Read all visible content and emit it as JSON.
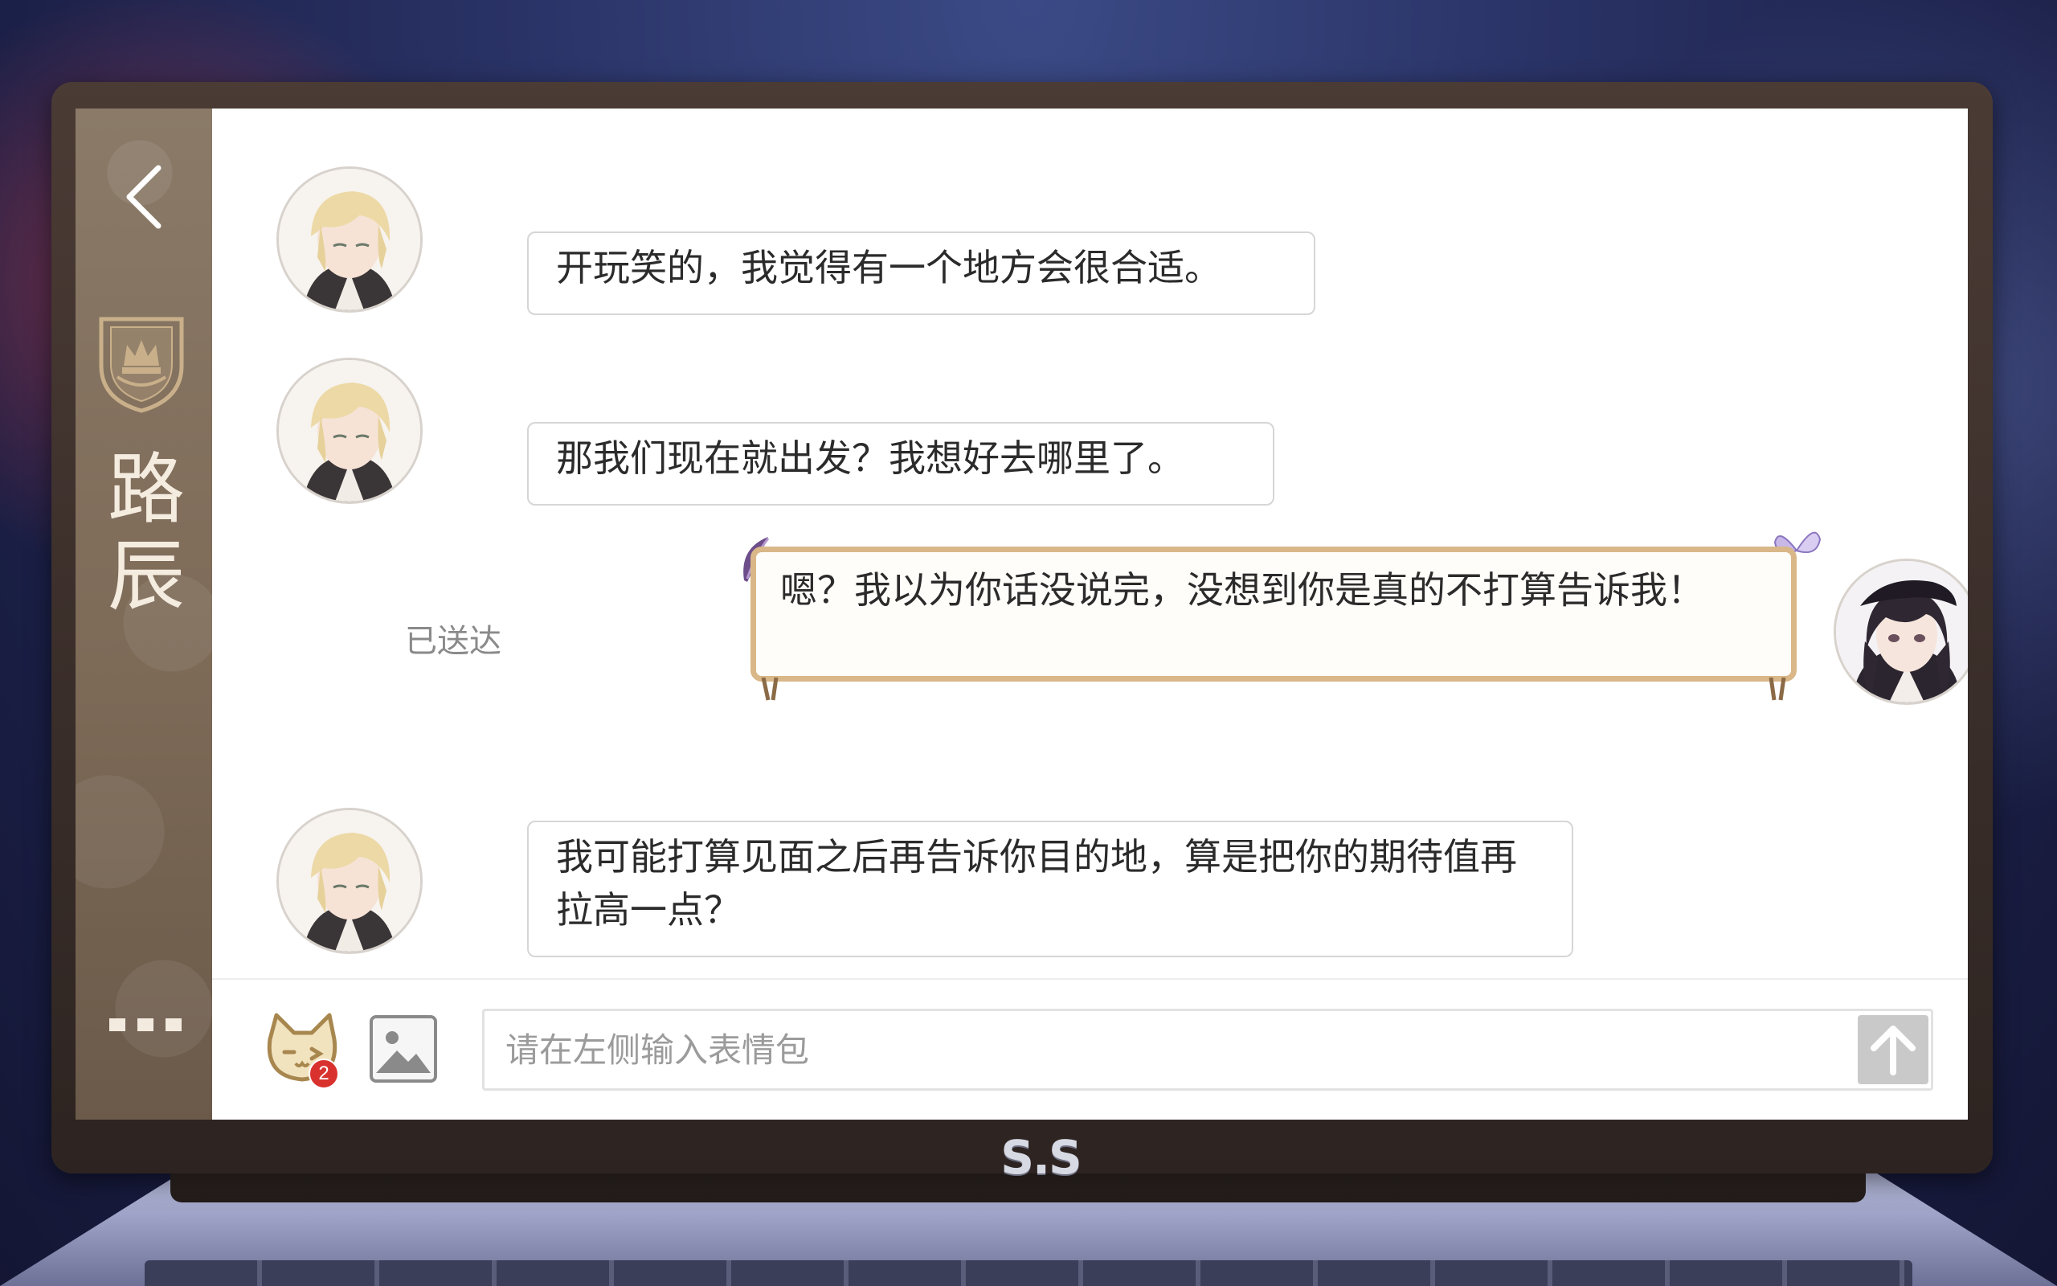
{
  "contact": {
    "name": "路辰"
  },
  "messages": [
    {
      "sender": "contact",
      "text": "开玩笑的，我觉得有一个地方会很合适。"
    },
    {
      "sender": "contact",
      "text": "那我们现在就出发？我想好去哪里了。"
    },
    {
      "sender": "self",
      "text": "嗯？我以为你话没说完，没想到你是真的不打算告诉我！",
      "status": "已送达"
    },
    {
      "sender": "contact",
      "text": "我可能打算见面之后再告诉你目的地，算是把你的期待值再拉高一点？"
    }
  ],
  "input": {
    "placeholder": "请在左侧输入表情包",
    "value": ""
  },
  "sticker": {
    "badge_count": "2"
  },
  "device": {
    "brand": "S.S"
  },
  "icons": {
    "back": "chevron-left-icon",
    "crest": "crown-crest-icon",
    "more": "more-dots-icon",
    "sticker": "cat-sticker-icon",
    "image": "image-icon",
    "send": "arrow-up-icon"
  },
  "colors": {
    "sidebar": "#7d6a57",
    "self_bubble_border": "#d9b788",
    "badge": "#d9322e",
    "send_button": "#c9c9c9"
  }
}
